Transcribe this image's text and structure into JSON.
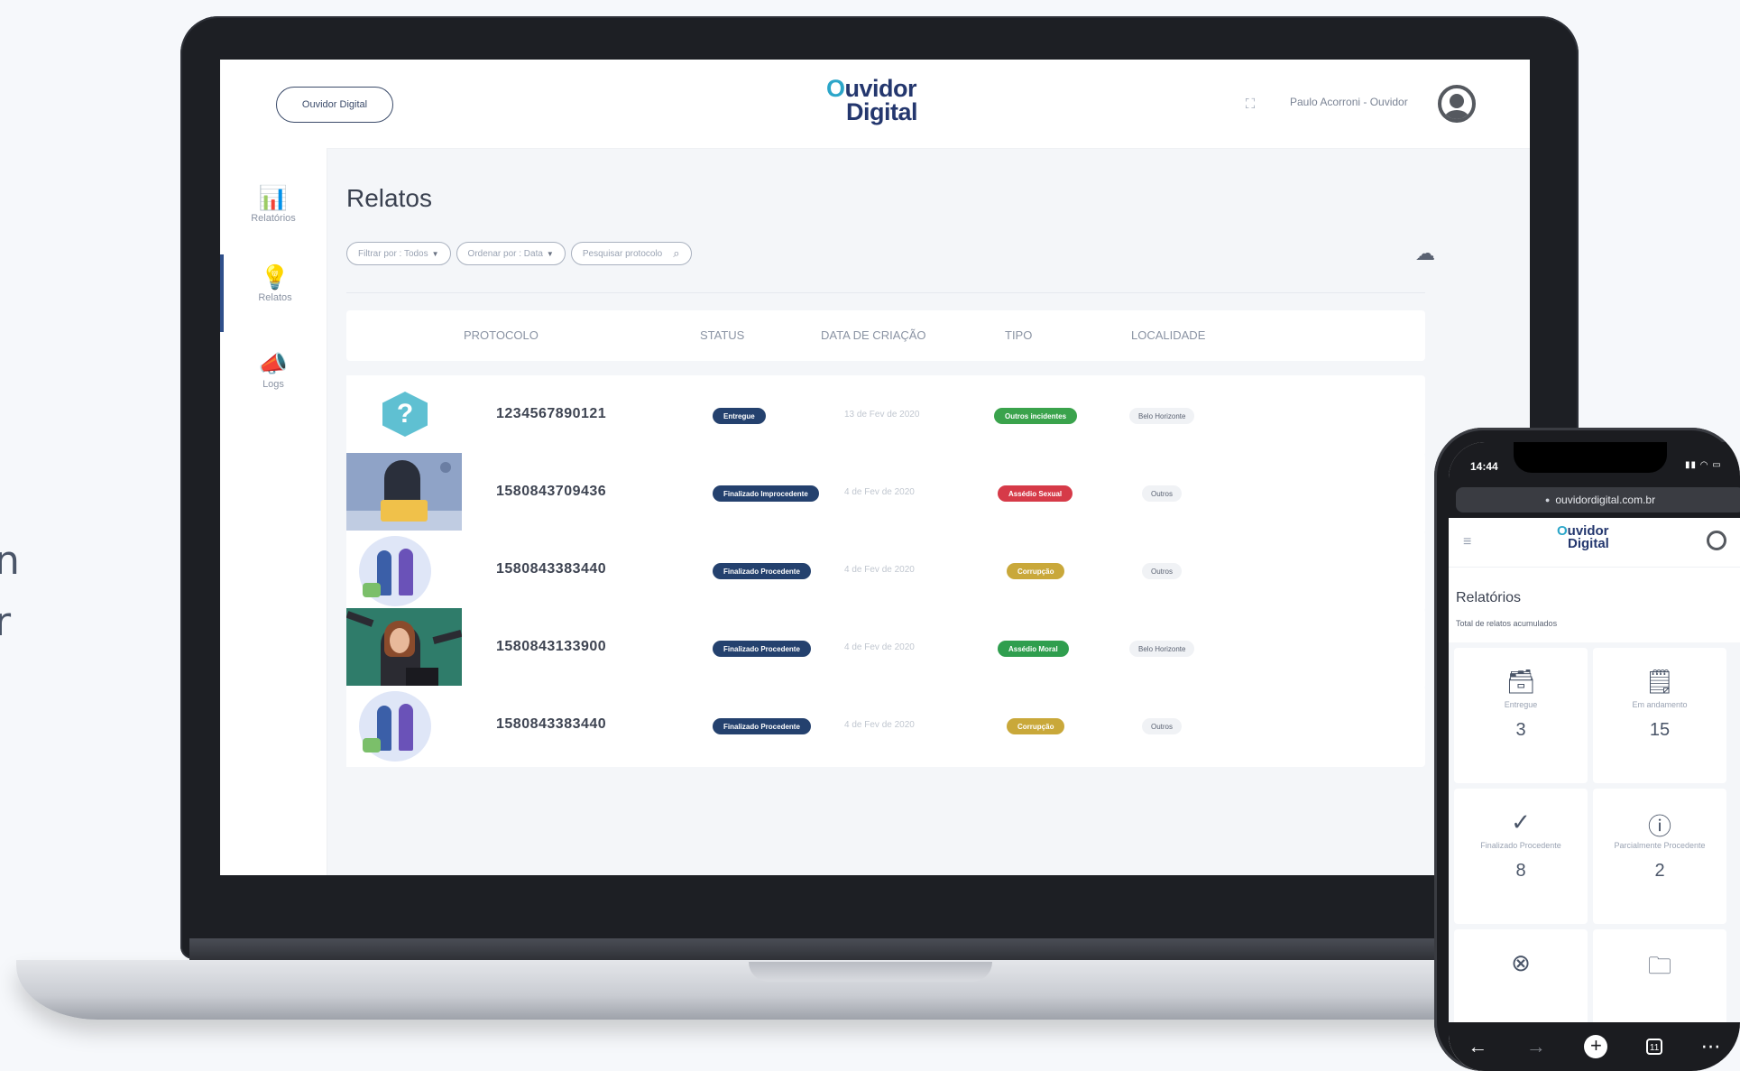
{
  "side_text": {
    "line1": "n",
    "line2": "r"
  },
  "laptop": {
    "topbar": {
      "pill_button": "Ouvidor Digital",
      "logo_line1": "Ouvidor",
      "logo_line2": "Digital",
      "user_name": "Paulo Acorroni - Ouvidor"
    },
    "sidebar": {
      "items": [
        {
          "label": "Relatórios",
          "icon": "bar-chart-icon"
        },
        {
          "label": "Relatos",
          "icon": "lightbulb-icon"
        },
        {
          "label": "Logs",
          "icon": "megaphone-icon"
        }
      ]
    },
    "main": {
      "title": "Relatos",
      "filters": {
        "filter_by": "Filtrar por : Todos",
        "order_by": "Ordenar por : Data",
        "search_placeholder": "Pesquisar protocolo"
      },
      "columns": [
        "PROTOCOLO",
        "STATUS",
        "DATA DE CRIAÇÃO",
        "TIPO",
        "LOCALIDADE"
      ],
      "rows": [
        {
          "protocol": "1234567890121",
          "status": "Entregue",
          "date": "13 de Fev de 2020",
          "tipo": "Outros incidentes",
          "tipo_color": "#3aa34c",
          "local": "Belo Horizonte"
        },
        {
          "protocol": "1580843709436",
          "status": "Finalizado Improcedente",
          "date": "4 de Fev de 2020",
          "tipo": "Assédio Sexual",
          "tipo_color": "#d63a48",
          "local": "Outros"
        },
        {
          "protocol": "1580843383440",
          "status": "Finalizado Procedente",
          "date": "4 de Fev de 2020",
          "tipo": "Corrupção",
          "tipo_color": "#c9a83a",
          "local": "Outros"
        },
        {
          "protocol": "1580843133900",
          "status": "Finalizado Procedente",
          "date": "4 de Fev de 2020",
          "tipo": "Assédio Moral",
          "tipo_color": "#2f9e4e",
          "local": "Belo Horizonte"
        },
        {
          "protocol": "1580843383440",
          "status": "Finalizado Procedente",
          "date": "4 de Fev de 2020",
          "tipo": "Corrupção",
          "tipo_color": "#c9a83a",
          "local": "Outros"
        }
      ]
    }
  },
  "phone": {
    "time": "14:44",
    "url": "ouvidordigital.com.br",
    "logo_line1": "Ouvidor",
    "logo_line2": "Digital",
    "title": "Relatórios",
    "subtitle": "Total de relatos acumulados",
    "cards": [
      {
        "label": "Entregue",
        "value": "3",
        "icon": "inbox-icon"
      },
      {
        "label": "Em andamento",
        "value": "15",
        "icon": "document-icon"
      },
      {
        "label": "Finalizado Procedente",
        "value": "8",
        "icon": "check-circle-icon"
      },
      {
        "label": "Parcialmente Procedente",
        "value": "2",
        "icon": "alert-circle-icon"
      }
    ],
    "tab_count": "11"
  }
}
